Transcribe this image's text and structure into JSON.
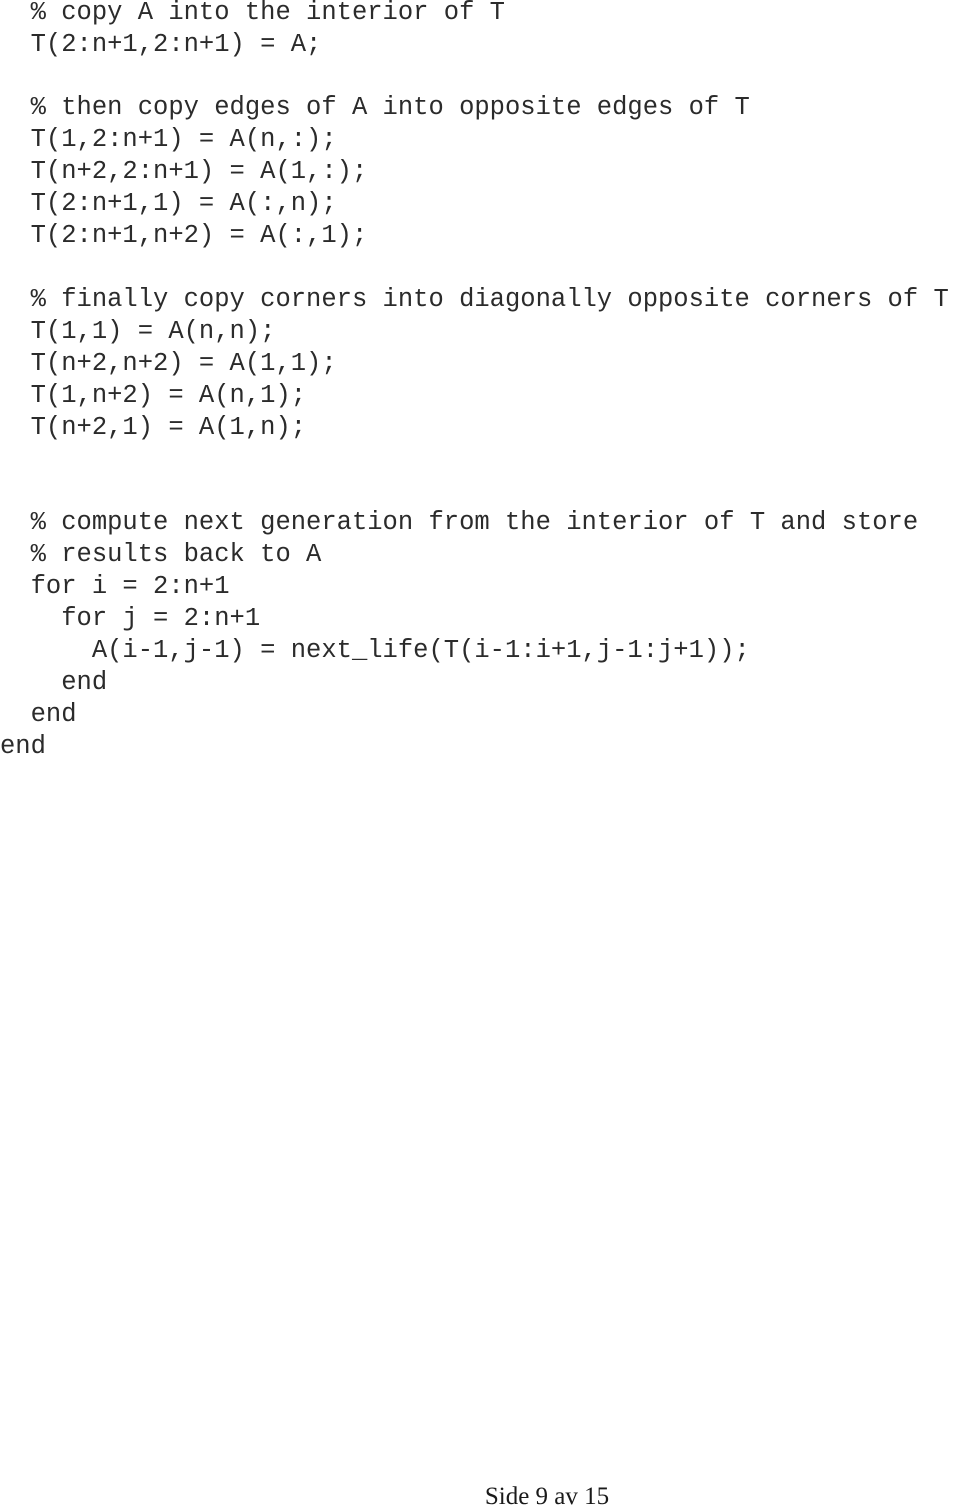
{
  "document": {
    "type": "code-listing",
    "language": "MATLAB",
    "lines": [
      "  % copy A into the interior of T",
      "  T(2:n+1,2:n+1) = A;",
      "",
      "  % then copy edges of A into opposite edges of T",
      "  T(1,2:n+1) = A(n,:);",
      "  T(n+2,2:n+1) = A(1,:);",
      "  T(2:n+1,1) = A(:,n);",
      "  T(2:n+1,n+2) = A(:,1);",
      "",
      "  % finally copy corners into diagonally opposite corners of T",
      "  T(1,1) = A(n,n);",
      "  T(n+2,n+2) = A(1,1);",
      "  T(1,n+2) = A(n,1);",
      "  T(n+2,1) = A(1,n);",
      "",
      "",
      "  % compute next generation from the interior of T and store",
      "  % results back to A",
      "  for i = 2:n+1",
      "    for j = 2:n+1",
      "      A(i-1,j-1) = next_life(T(i-1:i+1,j-1:j+1));",
      "    end",
      "  end",
      "end"
    ],
    "footer": "Side 9 av 15"
  }
}
